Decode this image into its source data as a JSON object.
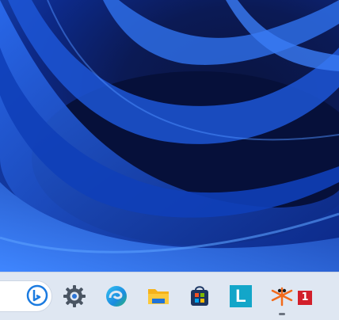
{
  "desktop": {
    "wallpaper": "windows-11-bloom-blue"
  },
  "taskbar": {
    "background": "#dfe7f2",
    "search_icon": "bing-icon",
    "items": [
      {
        "name": "settings",
        "icon": "gear-icon"
      },
      {
        "name": "edge",
        "icon": "edge-browser-icon"
      },
      {
        "name": "file-explorer",
        "icon": "folder-icon"
      },
      {
        "name": "microsoft-store",
        "icon": "store-icon"
      },
      {
        "name": "l-app",
        "icon": "letter-l-icon",
        "label": "L"
      },
      {
        "name": "running-app",
        "icon": "bug-icon",
        "badge": "1",
        "running": true
      }
    ]
  }
}
